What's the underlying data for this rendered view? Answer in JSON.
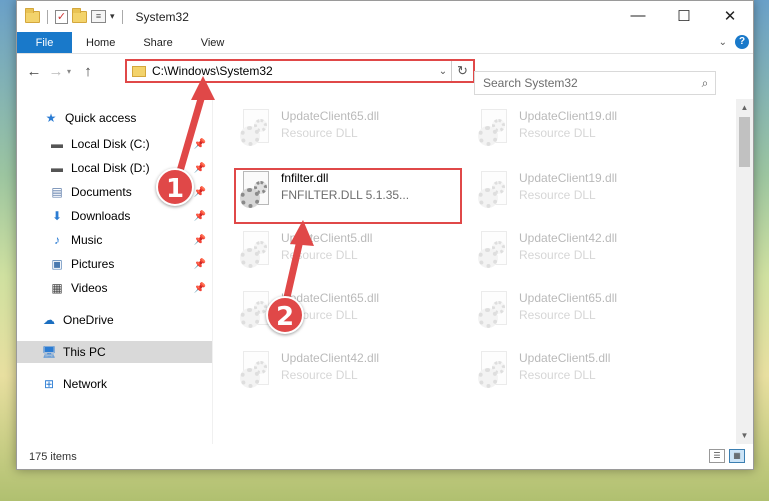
{
  "window": {
    "title": "System32",
    "controls": {
      "minimize": "—",
      "maximize": "☐",
      "close": "✕"
    }
  },
  "ribbon": {
    "file": "File",
    "tabs": [
      "Home",
      "Share",
      "View"
    ]
  },
  "address": {
    "path": "C:\\Windows\\System32",
    "search_placeholder": "Search System32"
  },
  "sidebar": {
    "items": [
      {
        "label": "Quick access",
        "icon": "star-icon",
        "pinned": false
      },
      {
        "label": "Local Disk (C:)",
        "icon": "drive-icon",
        "pinned": true
      },
      {
        "label": "Local Disk (D:)",
        "icon": "drive-icon",
        "pinned": true
      },
      {
        "label": "Documents",
        "icon": "documents-icon",
        "pinned": true
      },
      {
        "label": "Downloads",
        "icon": "downloads-icon",
        "pinned": true
      },
      {
        "label": "Music",
        "icon": "music-icon",
        "pinned": true
      },
      {
        "label": "Pictures",
        "icon": "pictures-icon",
        "pinned": true
      },
      {
        "label": "Videos",
        "icon": "videos-icon",
        "pinned": true
      },
      {
        "label": "OneDrive",
        "icon": "onedrive-icon",
        "pinned": false
      },
      {
        "label": "This PC",
        "icon": "this-pc-icon",
        "pinned": false,
        "selected": true
      },
      {
        "label": "Network",
        "icon": "network-icon",
        "pinned": false
      }
    ]
  },
  "files": {
    "highlighted": {
      "name": "fnfilter.dll",
      "desc": "FNFILTER.DLL 5.1.35..."
    },
    "left_col": [
      {
        "name": "UpdateClient65.dll",
        "desc": "Resource DLL"
      },
      {
        "name": "UpdateClient5.dll",
        "desc": "Resource DLL"
      },
      {
        "name": "UpdateClient65.dll",
        "desc": "Resource DLL"
      },
      {
        "name": "UpdateClient42.dll",
        "desc": "Resource DLL"
      }
    ],
    "right_col": [
      {
        "name": "UpdateClient19.dll",
        "desc": "Resource DLL"
      },
      {
        "name": "UpdateClient19.dll",
        "desc": "Resource DLL"
      },
      {
        "name": "UpdateClient42.dll",
        "desc": "Resource DLL"
      },
      {
        "name": "UpdateClient65.dll",
        "desc": "Resource DLL"
      },
      {
        "name": "UpdateClient5.dll",
        "desc": "Resource DLL"
      }
    ]
  },
  "status": {
    "count": "175 items"
  },
  "annotations": {
    "step1": "1",
    "step2": "2",
    "color": "#e04848"
  }
}
